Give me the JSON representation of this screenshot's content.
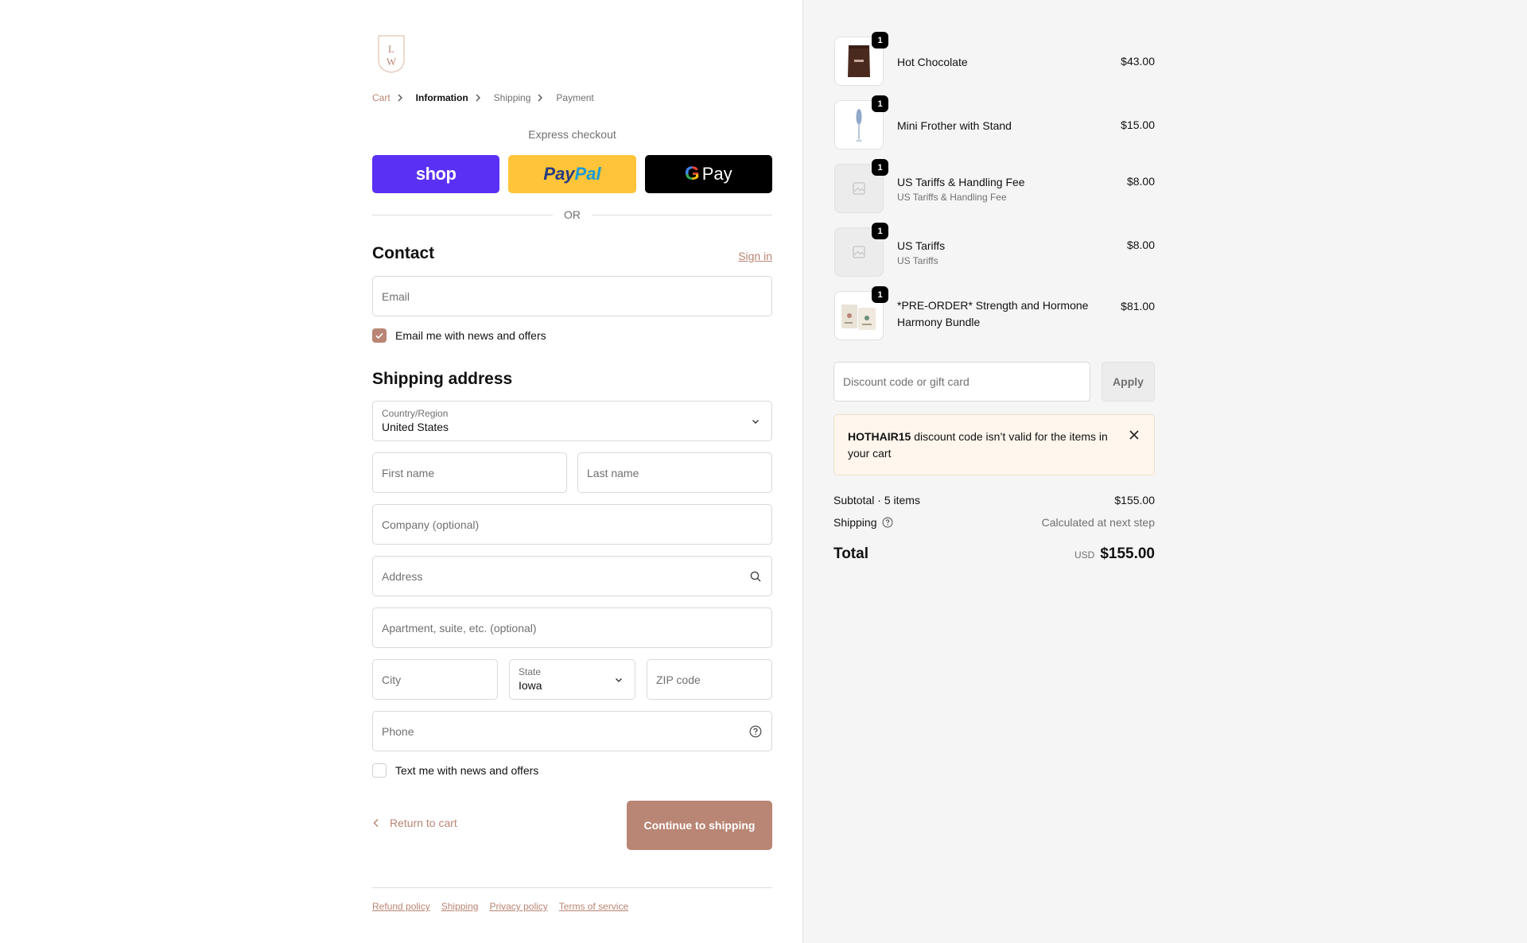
{
  "logo": {
    "letters": "LW"
  },
  "breadcrumb": [
    {
      "label": "Cart",
      "state": "link"
    },
    {
      "label": "Information",
      "state": "current"
    },
    {
      "label": "Shipping",
      "state": "upcoming"
    },
    {
      "label": "Payment",
      "state": "upcoming"
    }
  ],
  "express": {
    "title": "Express checkout",
    "shop_label": "shop",
    "paypal_part1": "Pay",
    "paypal_part2": "Pal",
    "gpay_g": "G",
    "gpay_label": "Pay",
    "or_label": "OR"
  },
  "contact": {
    "heading": "Contact",
    "signin_label": "Sign in",
    "email_placeholder": "Email",
    "newsletter_label": "Email me with news and offers",
    "newsletter_checked": true
  },
  "shipping": {
    "heading": "Shipping address",
    "country_label": "Country/Region",
    "country_value": "United States",
    "first_name_placeholder": "First name",
    "last_name_placeholder": "Last name",
    "company_placeholder": "Company (optional)",
    "address_placeholder": "Address",
    "apartment_placeholder": "Apartment, suite, etc. (optional)",
    "city_placeholder": "City",
    "state_label": "State",
    "state_value": "Iowa",
    "zip_placeholder": "ZIP code",
    "phone_placeholder": "Phone",
    "sms_label": "Text me with news and offers",
    "sms_checked": false
  },
  "actions": {
    "return_label": "Return to cart",
    "continue_label": "Continue to shipping"
  },
  "footer": {
    "links": [
      "Refund policy",
      "Shipping",
      "Privacy policy",
      "Terms of service"
    ]
  },
  "cart": {
    "items": [
      {
        "name": "Hot Chocolate",
        "subtitle": "",
        "price": "$43.00",
        "qty": "1",
        "thumb": "hot-chocolate-bag"
      },
      {
        "name": "Mini Frother with Stand",
        "subtitle": "",
        "price": "$15.00",
        "qty": "1",
        "thumb": "frother"
      },
      {
        "name": "US Tariffs & Handling Fee",
        "subtitle": "US Tariffs & Handling Fee",
        "price": "$8.00",
        "qty": "1",
        "thumb": "placeholder-image-icon"
      },
      {
        "name": "US Tariffs",
        "subtitle": "US Tariffs",
        "price": "$8.00",
        "qty": "1",
        "thumb": "placeholder-image-icon"
      },
      {
        "name": "*PRE-ORDER* Strength and Hormone Harmony Bundle",
        "subtitle": "",
        "price": "$81.00",
        "qty": "1",
        "thumb": "bundle-bags"
      }
    ],
    "discount_placeholder": "Discount code or gift card",
    "apply_label": "Apply",
    "alert_code": "HOTHAIR15",
    "alert_text": " discount code isn’t valid for the items in your cart",
    "subtotal_label": "Subtotal · 5 items",
    "subtotal_value": "$155.00",
    "shipping_label": "Shipping",
    "shipping_value": "Calculated at next step",
    "total_label": "Total",
    "total_currency": "USD",
    "total_value": "$155.00"
  },
  "colors": {
    "accent": "#b98574",
    "shop_pay": "#5a31f4",
    "paypal": "#ffc439",
    "alert_bg": "#fff6ed",
    "sidebar_bg": "#f5f5f5"
  }
}
